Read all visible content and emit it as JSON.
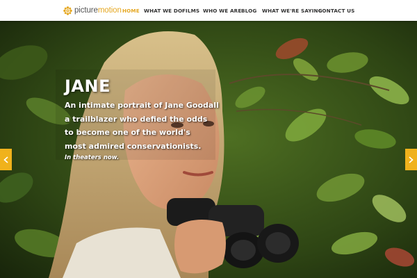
{
  "site": {
    "logo_prefix": "picture",
    "logo_suffix": "motion",
    "logo_icon": "sun-flower-icon",
    "accent_color": "#e5a823"
  },
  "nav": {
    "items": [
      {
        "label": "HOME",
        "active": true
      },
      {
        "label": "WHAT WE DO",
        "active": false
      },
      {
        "label": "FILMS",
        "active": false
      },
      {
        "label": "WHO WE ARE",
        "active": false
      },
      {
        "label": "BLOG",
        "active": false
      },
      {
        "label": "WHAT WE'RE SAYING",
        "active": false
      },
      {
        "label": "CONTACT US",
        "active": false
      }
    ]
  },
  "hero": {
    "title": "JANE",
    "lines": [
      "An intimate portrait of Jane Goodall",
      "a trailblazer who defied the odds",
      "to become one of the world's",
      "most admired conservationists."
    ],
    "tagline": "In theaters now.",
    "prev_icon": "chevron-left-icon",
    "next_icon": "chevron-right-icon",
    "arrow_color": "#f0b21c"
  }
}
